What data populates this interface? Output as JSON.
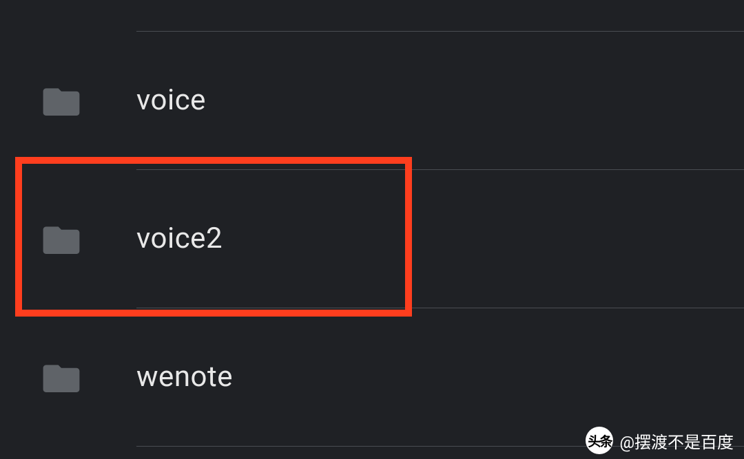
{
  "list": {
    "items": [
      {
        "label": "voice",
        "highlighted": false
      },
      {
        "label": "voice2",
        "highlighted": true
      },
      {
        "label": "wenote",
        "highlighted": false
      }
    ]
  },
  "watermark": {
    "logo_text": "头条",
    "label": "@摆渡不是百度"
  },
  "colors": {
    "background": "#1f2125",
    "divider": "#4a4d52",
    "folder_icon": "#5f6368",
    "text": "#e8e8e8",
    "highlight": "#ff3e1e"
  }
}
